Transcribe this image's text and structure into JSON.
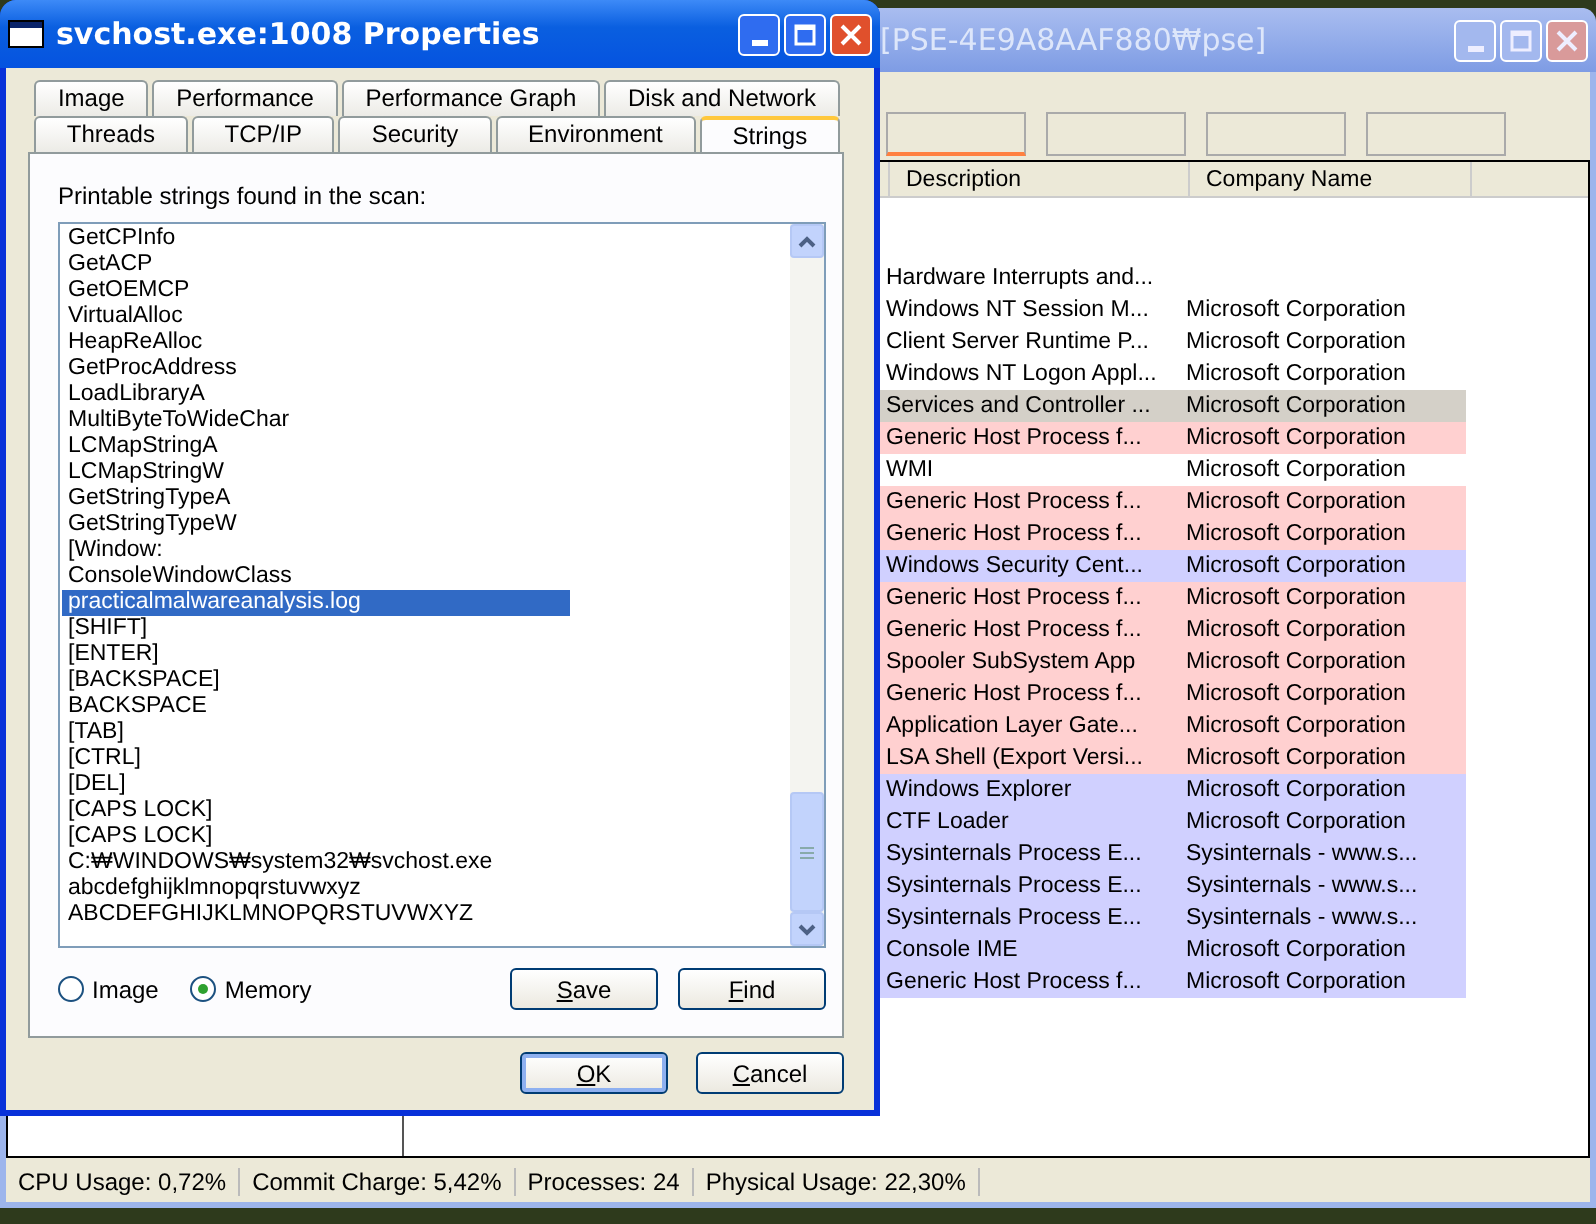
{
  "background_window": {
    "title": "[PSE-4E9A8AAF880₩pse]",
    "columns": [
      "Description",
      "Company Name"
    ],
    "rows": [
      {
        "description": "Hardware Interrupts and...",
        "company": "",
        "color": "#ffffff"
      },
      {
        "description": "Windows NT Session M...",
        "company": "Microsoft Corporation",
        "color": "#ffffff"
      },
      {
        "description": "Client Server Runtime P...",
        "company": "Microsoft Corporation",
        "color": "#ffffff"
      },
      {
        "description": "Windows NT Logon Appl...",
        "company": "Microsoft Corporation",
        "color": "#ffffff"
      },
      {
        "description": "Services and Controller ...",
        "company": "Microsoft Corporation",
        "color": "#d4d0c8"
      },
      {
        "description": "Generic Host Process f...",
        "company": "Microsoft Corporation",
        "color": "#ffd0d0"
      },
      {
        "description": "WMI",
        "company": "Microsoft Corporation",
        "color": "#ffffff"
      },
      {
        "description": "Generic Host Process f...",
        "company": "Microsoft Corporation",
        "color": "#ffd0d0"
      },
      {
        "description": "Generic Host Process f...",
        "company": "Microsoft Corporation",
        "color": "#ffd0d0"
      },
      {
        "description": "Windows Security Cent...",
        "company": "Microsoft Corporation",
        "color": "#d0d0ff"
      },
      {
        "description": "Generic Host Process f...",
        "company": "Microsoft Corporation",
        "color": "#ffd0d0"
      },
      {
        "description": "Generic Host Process f...",
        "company": "Microsoft Corporation",
        "color": "#ffd0d0"
      },
      {
        "description": "Spooler SubSystem App",
        "company": "Microsoft Corporation",
        "color": "#ffd0d0"
      },
      {
        "description": "Generic Host Process f...",
        "company": "Microsoft Corporation",
        "color": "#ffd0d0"
      },
      {
        "description": "Application Layer Gate...",
        "company": "Microsoft Corporation",
        "color": "#ffd0d0"
      },
      {
        "description": "LSA Shell (Export Versi...",
        "company": "Microsoft Corporation",
        "color": "#ffd0d0"
      },
      {
        "description": "Windows Explorer",
        "company": "Microsoft Corporation",
        "color": "#d0d0ff"
      },
      {
        "description": "CTF Loader",
        "company": "Microsoft Corporation",
        "color": "#d0d0ff"
      },
      {
        "description": "Sysinternals Process E...",
        "company": "Sysinternals - www.s...",
        "color": "#d0d0ff"
      },
      {
        "description": "Sysinternals Process E...",
        "company": "Sysinternals - www.s...",
        "color": "#d0d0ff"
      },
      {
        "description": "Sysinternals Process E...",
        "company": "Sysinternals - www.s...",
        "color": "#d0d0ff"
      },
      {
        "description": "Console IME",
        "company": "Microsoft Corporation",
        "color": "#d0d0ff"
      },
      {
        "description": "Generic Host Process f...",
        "company": "Microsoft Corporation",
        "color": "#d0d0ff"
      }
    ],
    "status_bar": [
      "CPU Usage: 0,72%",
      "Commit Charge: 5,42%",
      "Processes: 24",
      "Physical Usage: 22,30%"
    ]
  },
  "dialog": {
    "title": "svchost.exe:1008 Properties",
    "tab_rows": [
      {
        "tabs": [
          {
            "label": "Image",
            "selected": false
          },
          {
            "label": "Performance",
            "selected": false
          },
          {
            "label": "Performance Graph",
            "selected": false
          },
          {
            "label": "Disk and Network",
            "selected": false
          }
        ]
      },
      {
        "tabs": [
          {
            "label": "Threads",
            "selected": false
          },
          {
            "label": "TCP/IP",
            "selected": false
          },
          {
            "label": "Security",
            "selected": false
          },
          {
            "label": "Environment",
            "selected": false
          },
          {
            "label": "Strings",
            "selected": true
          }
        ]
      }
    ],
    "caption": "Printable strings found in the scan:",
    "strings": [
      {
        "text": "GetCPInfo",
        "selected": false
      },
      {
        "text": "GetACP",
        "selected": false
      },
      {
        "text": "GetOEMCP",
        "selected": false
      },
      {
        "text": "VirtualAlloc",
        "selected": false
      },
      {
        "text": "HeapReAlloc",
        "selected": false
      },
      {
        "text": "GetProcAddress",
        "selected": false
      },
      {
        "text": "LoadLibraryA",
        "selected": false
      },
      {
        "text": "MultiByteToWideChar",
        "selected": false
      },
      {
        "text": "LCMapStringA",
        "selected": false
      },
      {
        "text": "LCMapStringW",
        "selected": false
      },
      {
        "text": "GetStringTypeA",
        "selected": false
      },
      {
        "text": "GetStringTypeW",
        "selected": false
      },
      {
        "text": "[Window:",
        "selected": false
      },
      {
        "text": "ConsoleWindowClass",
        "selected": false
      },
      {
        "text": "practicalmalwareanalysis.log",
        "selected": true
      },
      {
        "text": "[SHIFT]",
        "selected": false
      },
      {
        "text": "[ENTER]",
        "selected": false
      },
      {
        "text": "[BACKSPACE]",
        "selected": false
      },
      {
        "text": "BACKSPACE",
        "selected": false
      },
      {
        "text": "[TAB]",
        "selected": false
      },
      {
        "text": "[CTRL]",
        "selected": false
      },
      {
        "text": "[DEL]",
        "selected": false
      },
      {
        "text": "[CAPS LOCK]",
        "selected": false
      },
      {
        "text": "[CAPS LOCK]",
        "selected": false
      },
      {
        "text": "C:₩WINDOWS₩system32₩svchost.exe",
        "selected": false
      },
      {
        "text": "abcdefghijklmnopqrstuvwxyz",
        "selected": false
      },
      {
        "text": "ABCDEFGHIJKLMNOPQRSTUVWXYZ",
        "selected": false
      }
    ],
    "radios": [
      {
        "label": "Image",
        "selected": false
      },
      {
        "label": "Memory",
        "selected": true
      }
    ],
    "panel_buttons": [
      "Save",
      "Find"
    ],
    "buttons": [
      {
        "label": "OK",
        "kind": "default"
      },
      {
        "label": "Cancel",
        "kind": "normal"
      }
    ]
  }
}
